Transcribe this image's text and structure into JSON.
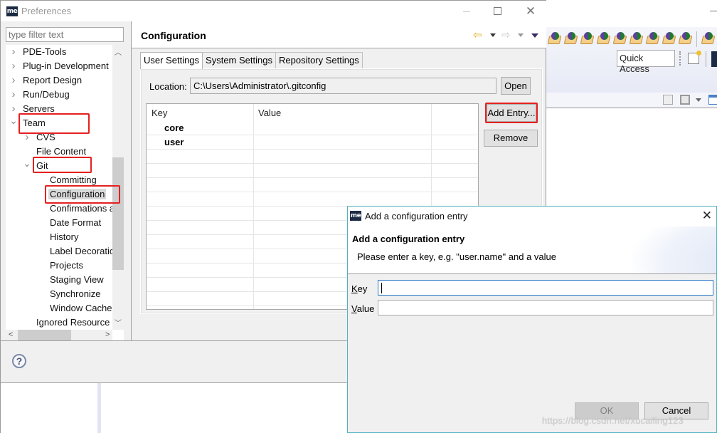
{
  "background_workbench": {
    "quick_access_label": "Quick Access",
    "toolbar_icons": [
      "package-icon",
      "package-icon",
      "package-icon",
      "package-icon",
      "package-icon",
      "package-icon",
      "package-icon",
      "package-icon",
      "package-icon",
      "package-icon",
      "package-icon"
    ]
  },
  "preferences": {
    "title": "Preferences",
    "logo_text": "me",
    "filter_placeholder": "type filter text",
    "tree": [
      {
        "label": "PDE-Tools",
        "level": 0,
        "twisty": ">"
      },
      {
        "label": "Plug-in Development",
        "level": 0,
        "twisty": ">"
      },
      {
        "label": "Report Design",
        "level": 0,
        "twisty": ">"
      },
      {
        "label": "Run/Debug",
        "level": 0,
        "twisty": ">"
      },
      {
        "label": "Servers",
        "level": 0,
        "twisty": ">"
      },
      {
        "label": "Team",
        "level": 0,
        "twisty": "v",
        "highlighted": true
      },
      {
        "label": "CVS",
        "level": 1,
        "twisty": ">"
      },
      {
        "label": "File Content",
        "level": 1,
        "twisty": ""
      },
      {
        "label": "Git",
        "level": 1,
        "twisty": "v",
        "highlighted": true
      },
      {
        "label": "Committing",
        "level": 2,
        "twisty": ""
      },
      {
        "label": "Configuration",
        "level": 2,
        "twisty": "",
        "selected": true,
        "highlighted": true
      },
      {
        "label": "Confirmations a",
        "level": 2,
        "twisty": ""
      },
      {
        "label": "Date Format",
        "level": 2,
        "twisty": ""
      },
      {
        "label": "History",
        "level": 2,
        "twisty": ""
      },
      {
        "label": "Label Decoratic",
        "level": 2,
        "twisty": ""
      },
      {
        "label": "Projects",
        "level": 2,
        "twisty": ""
      },
      {
        "label": "Staging View",
        "level": 2,
        "twisty": ""
      },
      {
        "label": "Synchronize",
        "level": 2,
        "twisty": ""
      },
      {
        "label": "Window Cache",
        "level": 2,
        "twisty": ""
      },
      {
        "label": "Ignored Resource",
        "level": 1,
        "twisty": ""
      }
    ],
    "page": {
      "title": "Configuration",
      "tabs": [
        {
          "label": "User Settings",
          "active": true
        },
        {
          "label": "System Settings",
          "active": false
        },
        {
          "label": "Repository Settings",
          "active": false
        }
      ],
      "location_label": "Location:",
      "location_value": "C:\\Users\\Administrator\\.gitconfig",
      "open_button": "Open",
      "table": {
        "columns": [
          "Key",
          "Value"
        ],
        "rows": [
          {
            "key": "core",
            "value": ""
          },
          {
            "key": "user",
            "value": ""
          }
        ]
      },
      "add_entry_button": "Add Entry...",
      "remove_button": "Remove"
    }
  },
  "dialog": {
    "title": "Add a configuration entry",
    "logo_text": "me",
    "heading": "Add a configuration entry",
    "description": "Please enter a key, e.g. \"user.name\" and a value",
    "key_label_mnemonic": "K",
    "key_label_rest": "ey",
    "key_value": "",
    "value_label_mnemonic": "V",
    "value_label_rest": "alue",
    "value_value": "",
    "ok_button": "OK",
    "cancel_button": "Cancel",
    "ok_enabled": false
  },
  "watermark": "https://blog.csdn.net/xucailing123",
  "colors": {
    "highlight_box": "#e62020",
    "dialog_border": "#4fb3bf",
    "logo_bg": "#1b2b45"
  }
}
